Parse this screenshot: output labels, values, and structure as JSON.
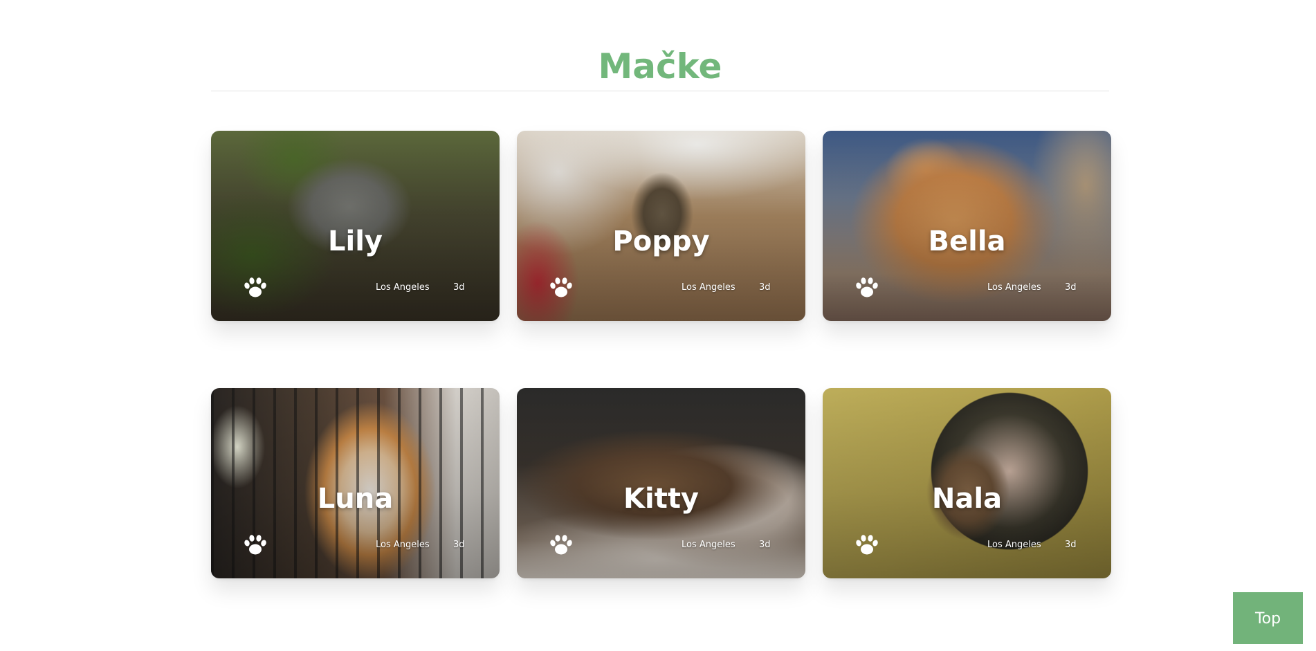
{
  "section": {
    "title": "Mačke"
  },
  "cats": [
    {
      "name": "Lily",
      "location": "Los Angeles",
      "age": "3d"
    },
    {
      "name": "Poppy",
      "location": "Los Angeles",
      "age": "3d"
    },
    {
      "name": "Bella",
      "location": "Los Angeles",
      "age": "3d"
    },
    {
      "name": "Luna",
      "location": "Los Angeles",
      "age": "3d"
    },
    {
      "name": "Kitty",
      "location": "Los Angeles",
      "age": "3d"
    },
    {
      "name": "Nala",
      "location": "Los Angeles",
      "age": "3d"
    }
  ],
  "icons": {
    "card_icon": "paw-icon"
  },
  "colors": {
    "accent": "#72b77b",
    "top_button": "#72b37a"
  },
  "top_button": {
    "label": "Top"
  }
}
